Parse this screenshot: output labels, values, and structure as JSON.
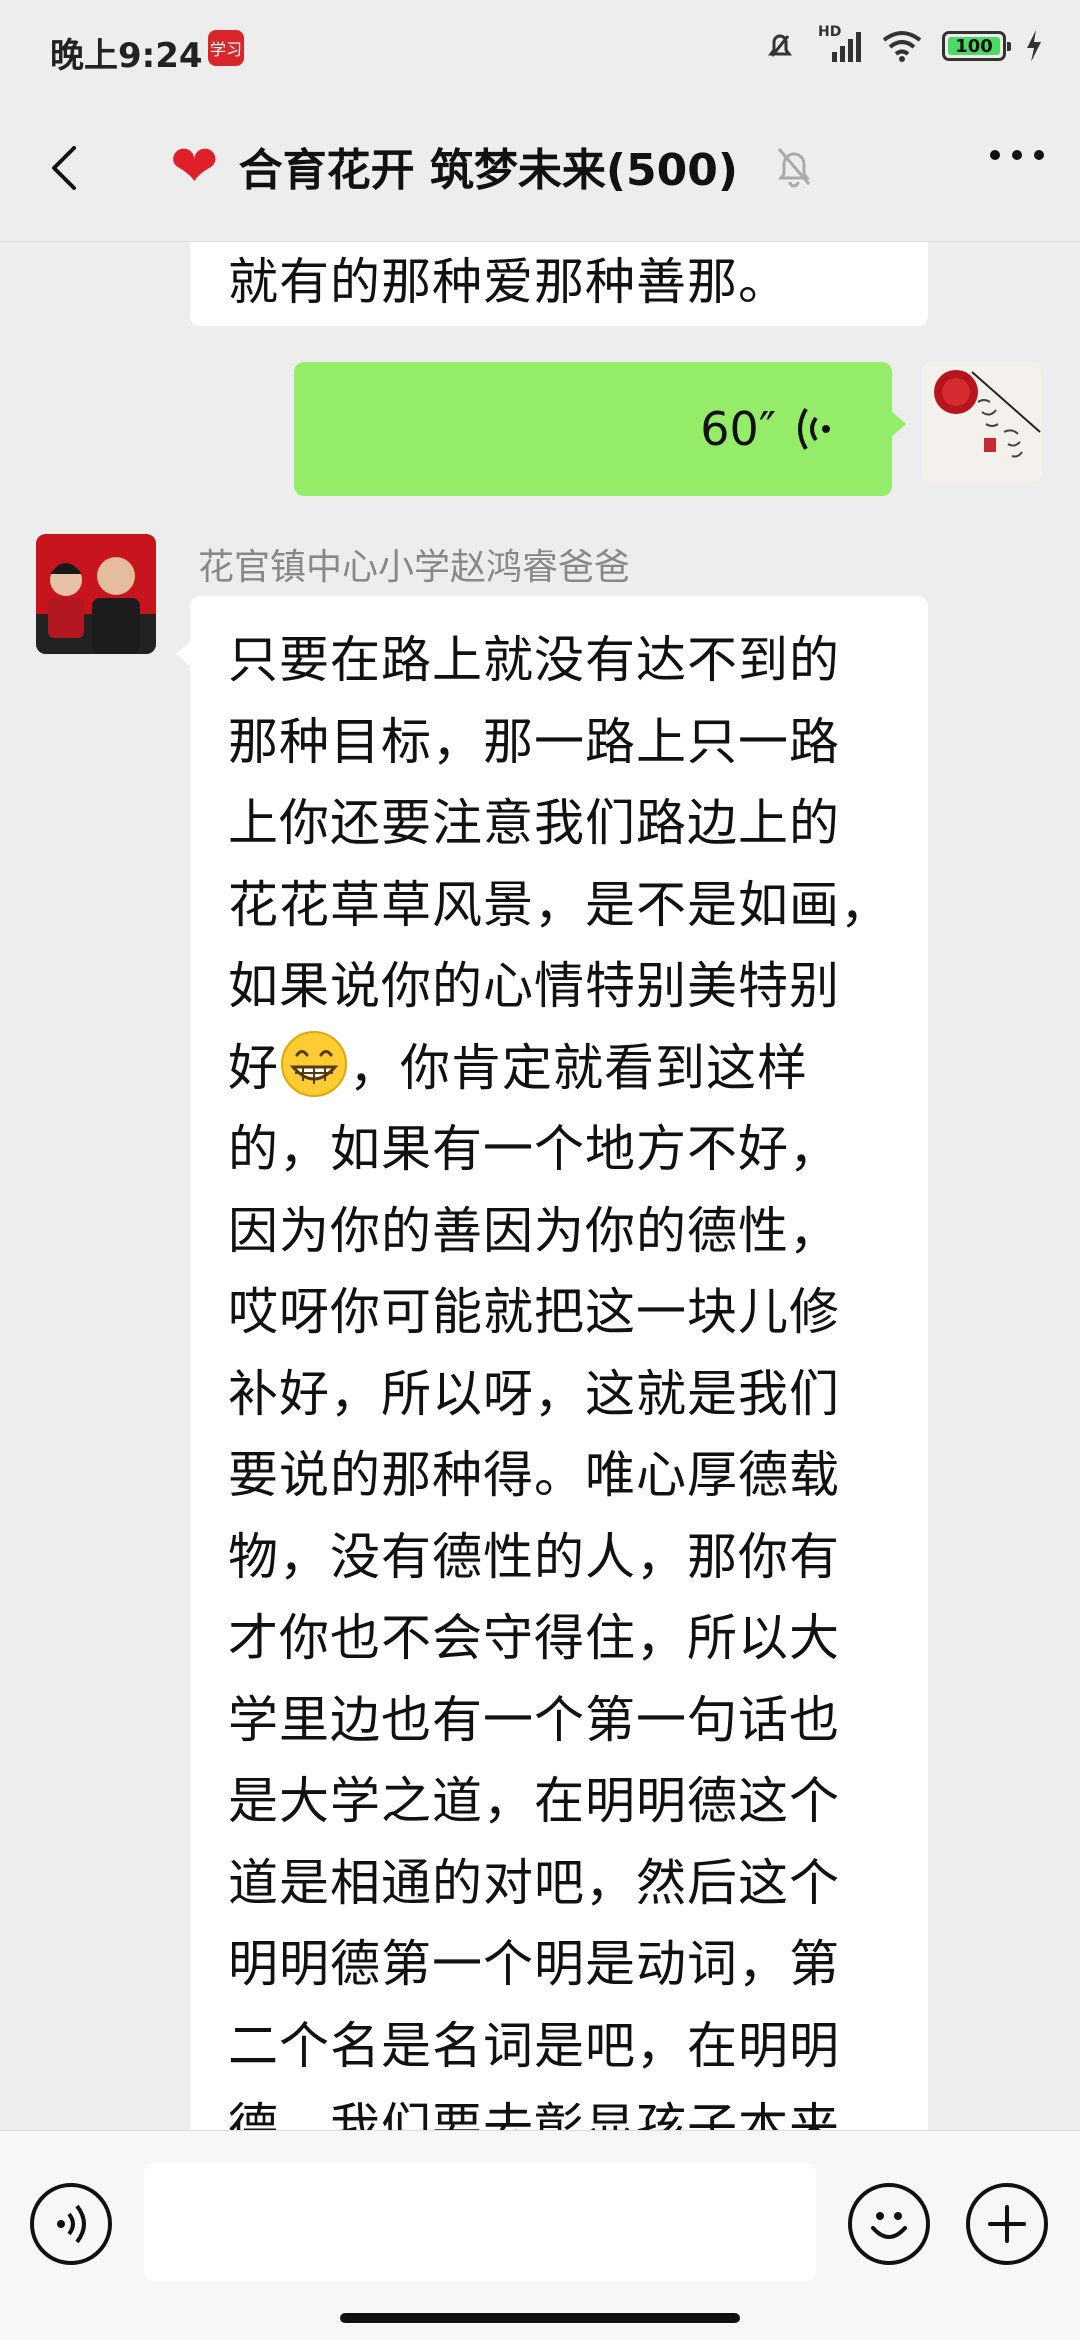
{
  "status_bar": {
    "time": "晚上9:24",
    "app_badge": "学习",
    "battery": "100",
    "signal_label": "HD"
  },
  "nav": {
    "title": "合育花开 筑梦未来(500)",
    "heart_icon": "red-heart"
  },
  "messages": {
    "prev_text": "就有的那种爱那种善那。",
    "voice": {
      "duration": "60″"
    },
    "sender_name": "花官镇中心小学赵鸿睿爸爸",
    "main_lines": [
      "只要在路上就没有达不到的",
      "那种目标，那一路上只一路",
      "上你还要注意我们路边上的",
      "花花草草风景，是不是如画，",
      "如果说你的心情特别美特别",
      "好",
      "，你肯定就看到这样",
      "的，如果有一个地方不好，",
      "因为你的善因为你的德性，",
      "哎呀你可能就把这一块儿修",
      "补好，所以呀，这就是我们",
      "要说的那种得。唯心厚德载",
      "物，没有德性的人，那你有",
      "才你也不会守得住，所以大",
      "学里边也有一个第一句话也",
      "是大学之道，在明明德这个",
      "道是相通的对吧，然后这个",
      "明明德第一个明是动词，第",
      "二个名是名词是吧，在明明",
      "德，我们要去彰显孩子本来"
    ]
  },
  "input": {
    "placeholder": ""
  },
  "colors": {
    "background": "#ededed",
    "self_bubble": "#95ec69",
    "other_bubble": "#ffffff",
    "heart": "#e01f2a"
  }
}
